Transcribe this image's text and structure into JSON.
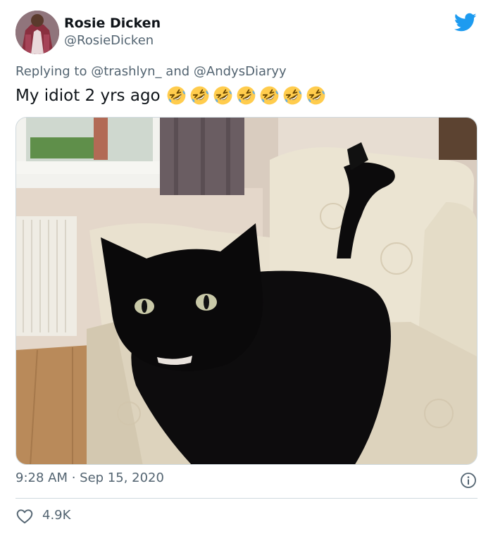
{
  "author": {
    "display_name": "Rosie Dicken",
    "handle": "@RosieDicken"
  },
  "reply": {
    "prefix": "Replying to",
    "mention_1": "@trashlyn_",
    "conjunction": "and",
    "mention_2": "@AndysDiaryy"
  },
  "tweet": {
    "text": "My idiot 2 yrs ago",
    "emoji_name": "rolling-on-the-floor-laughing",
    "emoji_count": 7
  },
  "meta": {
    "timestamp": "9:28 AM · Sep 15, 2020",
    "like_count": "4.9K"
  },
  "colors": {
    "twitter_blue": "#1d9bf0",
    "secondary_text": "#536471",
    "border": "#cfd9de"
  }
}
